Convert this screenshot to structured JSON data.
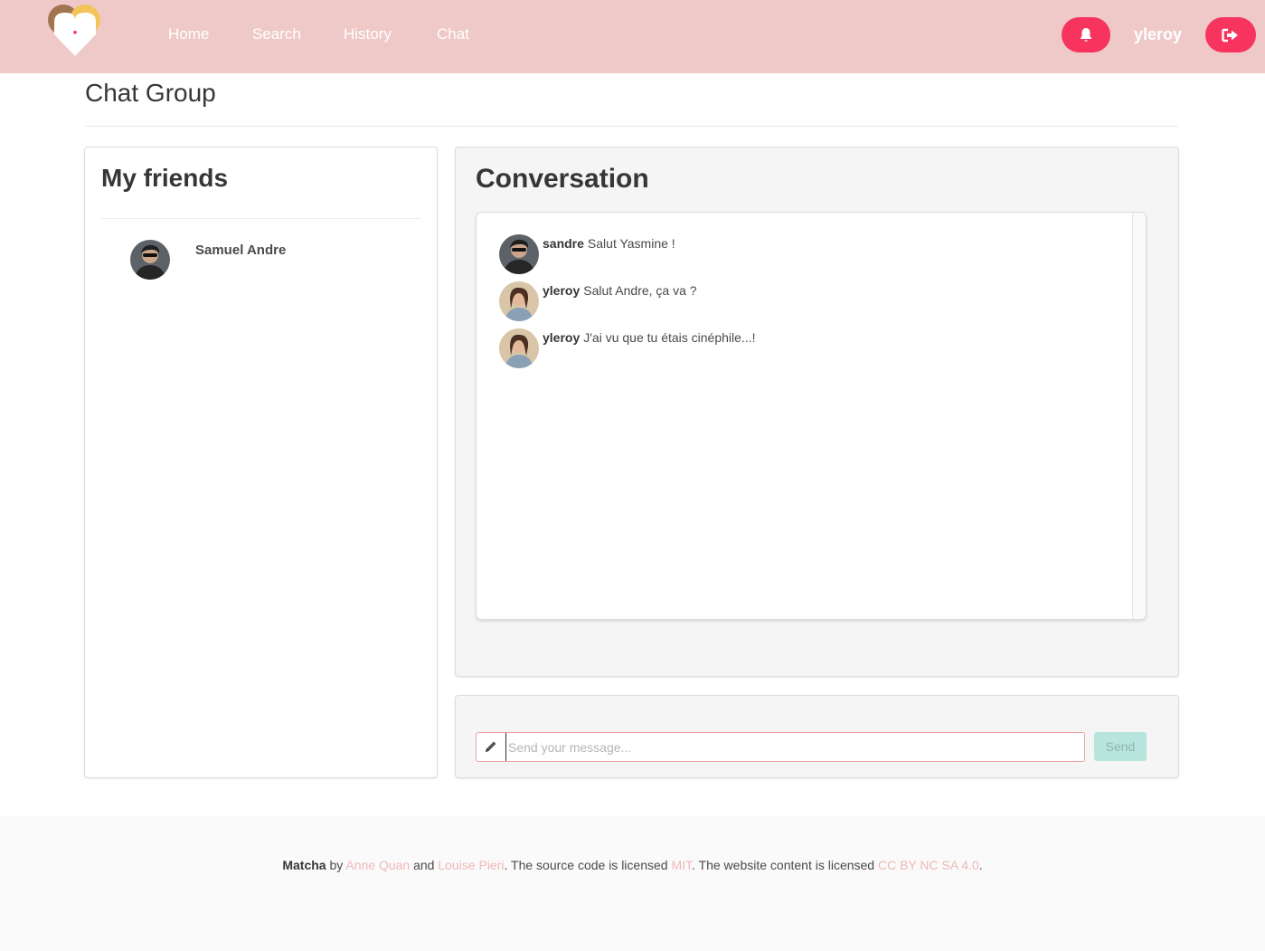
{
  "nav": {
    "logo_icon": "heart-logo-icon",
    "links": [
      {
        "label": "Home"
      },
      {
        "label": "Search"
      },
      {
        "label": "History"
      },
      {
        "label": "Chat"
      }
    ],
    "bell_icon": "bell-icon",
    "username": "yleroy",
    "logout_icon": "sign-out-icon"
  },
  "page": {
    "title": "Chat Group"
  },
  "friends": {
    "title": "My friends",
    "items": [
      {
        "name": "Samuel Andre"
      }
    ]
  },
  "conversation": {
    "title": "Conversation",
    "messages": [
      {
        "author": "sandre",
        "text": "Salut Yasmine !"
      },
      {
        "author": "yleroy",
        "text": "Salut Andre, ça va ?"
      },
      {
        "author": "yleroy",
        "text": "J'ai vu que tu étais cinéphile...!"
      }
    ]
  },
  "composer": {
    "placeholder": "Send your message...",
    "value": "",
    "send_label": "Send",
    "pencil_icon": "pencil-icon"
  },
  "footer": {
    "brand": "Matcha",
    "by": " by ",
    "author1": "Anne Quan",
    "and": " and ",
    "author2": "Louise Pieri",
    "code_text": ". The source code is licensed ",
    "code_license": "MIT",
    "content_text": ". The website content is licensed ",
    "content_license": "CC BY NC SA 4.0",
    "end": "."
  },
  "colors": {
    "navbar_bg": "#efc9c7",
    "accent": "#f7345e",
    "send_button": "#b7e4dc",
    "link": "#f0b8b8"
  }
}
